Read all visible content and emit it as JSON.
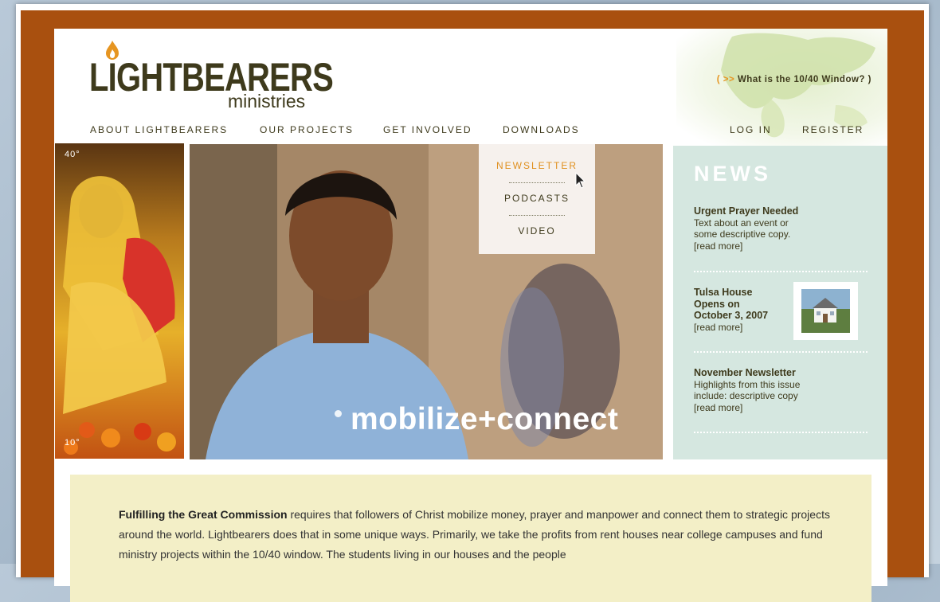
{
  "brand": {
    "name": "LIGHTBEARERS",
    "sub": "ministries",
    "window_link_prefix": "( >>",
    "window_link_text": "What is the 10/40 Window?",
    "window_link_suffix": ")"
  },
  "nav": {
    "items": [
      "ABOUT LIGHTBEARERS",
      "OUR PROJECTS",
      "GET INVOLVED",
      "DOWNLOADS"
    ],
    "login": "LOG IN",
    "register": "REGISTER"
  },
  "dropdown": {
    "items": [
      "NEWSLETTER",
      "PODCASTS",
      "VIDEO"
    ],
    "active": "NEWSLETTER"
  },
  "hero": {
    "degree_top": "40°",
    "degree_bottom": "10°",
    "tagline": "mobilize+connect"
  },
  "news": {
    "heading": "NEWS",
    "items": [
      {
        "title": "Urgent  Prayer Needed",
        "lines": [
          "Text about an event or",
          "some descriptive copy."
        ],
        "more": "[read more]"
      },
      {
        "title_lines": [
          "Tulsa House",
          "Opens on",
          "October 3, 2007"
        ],
        "more": "[read more]"
      },
      {
        "title": "November Newsletter",
        "lines": [
          "Highlights from this issue",
          "include: descriptive copy"
        ],
        "more": "[read more]"
      }
    ]
  },
  "intro": {
    "lead": "Fulfilling the Great Commission",
    "text": " requires that followers of Christ mobilize money, prayer and manpower and connect them to strategic projects around the world. Lightbearers does that in some unique ways. Primarily, we take the profits from rent houses near college campuses and fund ministry projects within the 10/40 window. The students living in our houses and the people"
  },
  "colors": {
    "frame": "#a9500f",
    "brand_text": "#3e3a1c",
    "accent": "#e0901f",
    "news_bg": "#d5e7e0",
    "intro_bg": "#f3efc7"
  }
}
